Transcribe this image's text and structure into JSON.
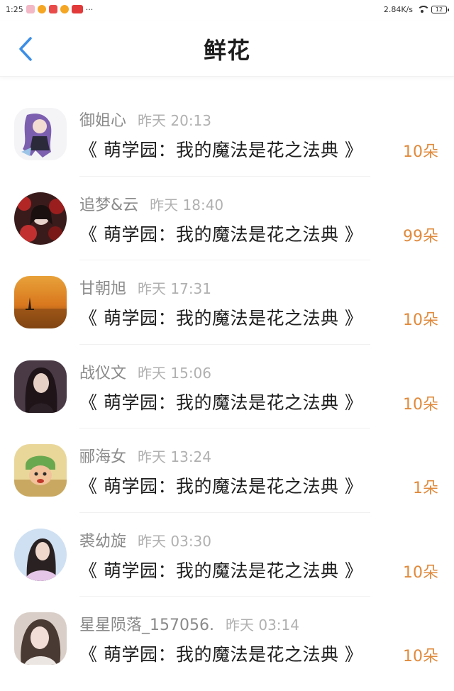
{
  "status_bar": {
    "time": "1:25",
    "more": "···",
    "net_speed": "2.84K/s",
    "battery": "12"
  },
  "header": {
    "title": "鲜花"
  },
  "records": [
    {
      "name": "御姐心",
      "time": "昨天 20:13",
      "book": "《 萌学园：我的魔法是花之法典 》",
      "amount": "10朵"
    },
    {
      "name": "追梦&云",
      "time": "昨天 18:40",
      "book": "《 萌学园：我的魔法是花之法典 》",
      "amount": "99朵"
    },
    {
      "name": "甘朝旭",
      "time": "昨天 17:31",
      "book": "《 萌学园：我的魔法是花之法典 》",
      "amount": "10朵"
    },
    {
      "name": "战仪文",
      "time": "昨天 15:06",
      "book": "《 萌学园：我的魔法是花之法典 》",
      "amount": "10朵"
    },
    {
      "name": "郦海女",
      "time": "昨天 13:24",
      "book": "《 萌学园：我的魔法是花之法典 》",
      "amount": "1朵"
    },
    {
      "name": "裘幼旋",
      "time": "昨天 03:30",
      "book": "《 萌学园：我的魔法是花之法典 》",
      "amount": "10朵"
    },
    {
      "name": "星星陨落_157056.",
      "time": "昨天 03:14",
      "book": "《 萌学园：我的魔法是花之法典 》",
      "amount": "10朵"
    }
  ],
  "colors": {
    "accent_blue": "#3a8ee6",
    "amount_orange": "#e08a3c"
  }
}
